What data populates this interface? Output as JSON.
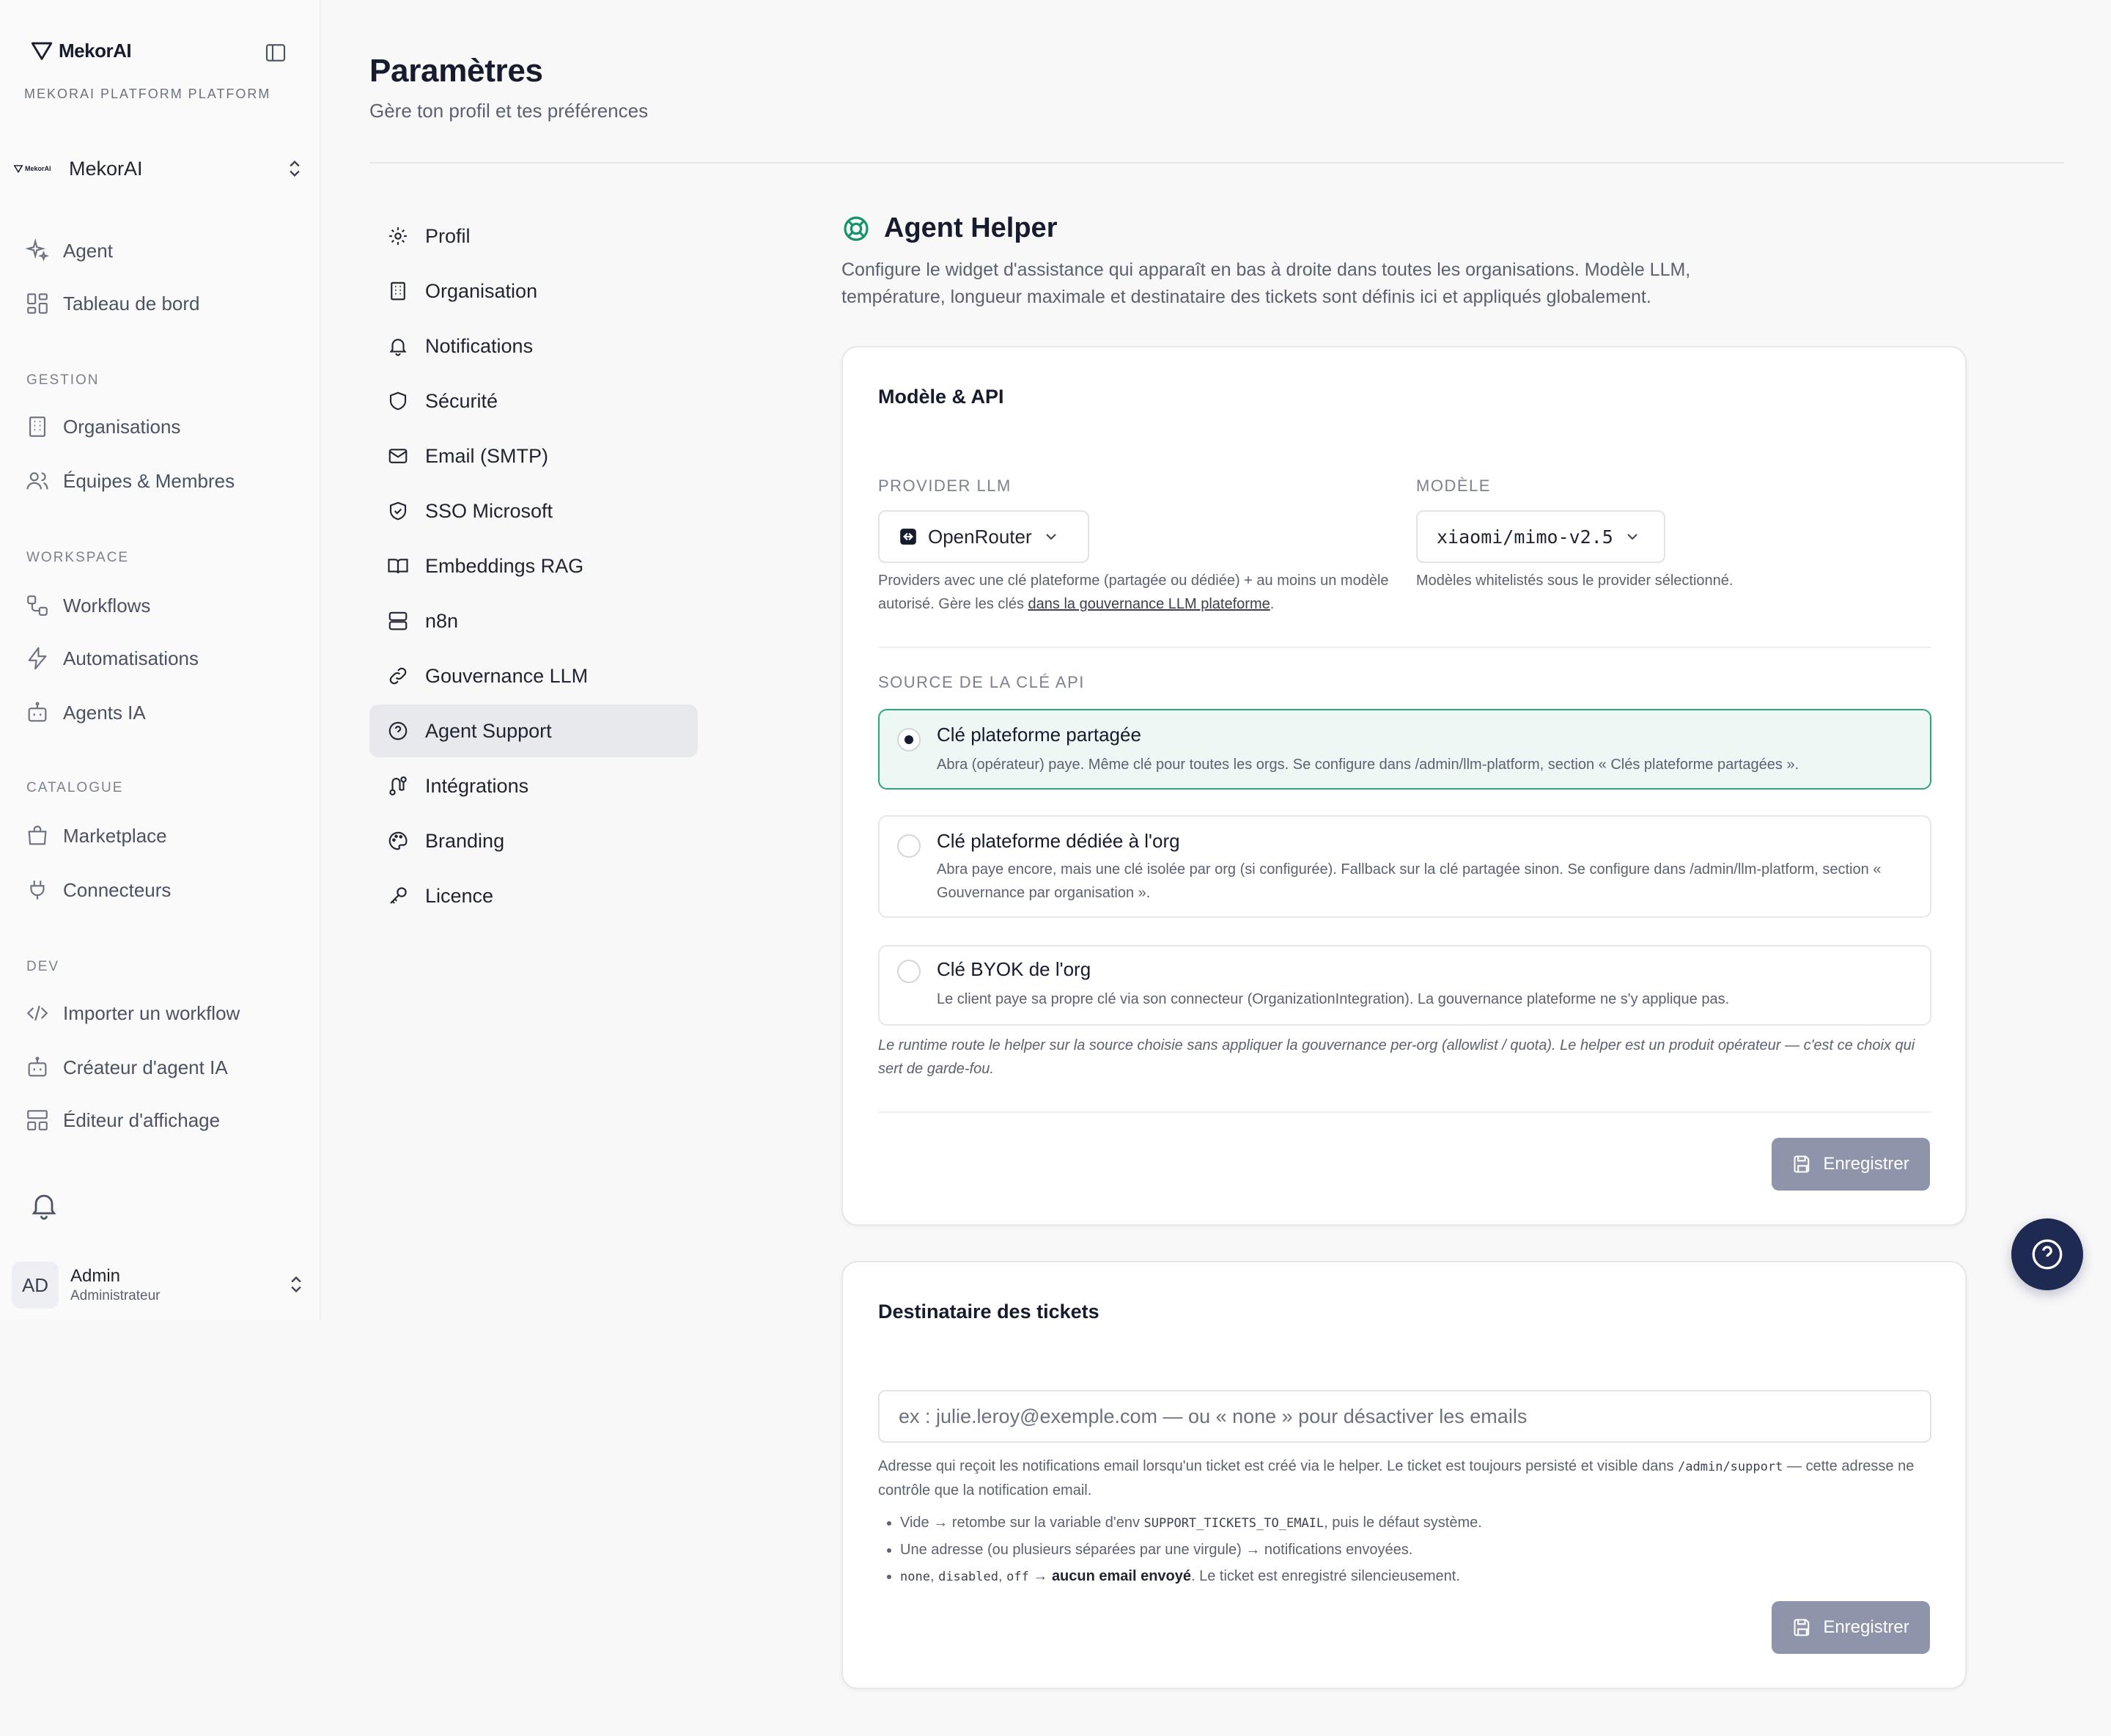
{
  "sidebar": {
    "brand": "MekorAI",
    "platform_label": "MEKORAI PLATFORM PLATFORM",
    "org": {
      "logo_text": "MekorAI",
      "name": "MekorAI"
    },
    "top_items": [
      {
        "label": "Agent",
        "icon": "sparkles-icon"
      },
      {
        "label": "Tableau de bord",
        "icon": "dashboard-icon"
      }
    ],
    "sections": [
      {
        "title": "GESTION",
        "items": [
          {
            "label": "Organisations",
            "icon": "building-icon"
          },
          {
            "label": "Équipes & Membres",
            "icon": "users-icon"
          }
        ]
      },
      {
        "title": "WORKSPACE",
        "items": [
          {
            "label": "Workflows",
            "icon": "workflow-icon"
          },
          {
            "label": "Automatisations",
            "icon": "zap-icon"
          },
          {
            "label": "Agents IA",
            "icon": "bot-icon"
          }
        ]
      },
      {
        "title": "CATALOGUE",
        "items": [
          {
            "label": "Marketplace",
            "icon": "store-icon"
          },
          {
            "label": "Connecteurs",
            "icon": "plug-icon"
          }
        ]
      },
      {
        "title": "DEV",
        "items": [
          {
            "label": "Importer un workflow",
            "icon": "code-icon"
          },
          {
            "label": "Créateur d'agent IA",
            "icon": "bot-icon"
          },
          {
            "label": "Éditeur d'affichage",
            "icon": "layout-icon"
          }
        ]
      }
    ],
    "user": {
      "initials": "AD",
      "name": "Admin",
      "role": "Administrateur"
    }
  },
  "header": {
    "title": "Paramètres",
    "subtitle": "Gère ton profil et tes préférences"
  },
  "settings_nav": [
    {
      "label": "Profil",
      "icon": "gear-icon"
    },
    {
      "label": "Organisation",
      "icon": "building-icon"
    },
    {
      "label": "Notifications",
      "icon": "bell-icon"
    },
    {
      "label": "Sécurité",
      "icon": "shield-icon"
    },
    {
      "label": "Email (SMTP)",
      "icon": "mail-icon"
    },
    {
      "label": "SSO Microsoft",
      "icon": "shield-check-icon"
    },
    {
      "label": "Embeddings RAG",
      "icon": "book-icon"
    },
    {
      "label": "n8n",
      "icon": "server-icon"
    },
    {
      "label": "Gouvernance LLM",
      "icon": "link-icon"
    },
    {
      "label": "Agent Support",
      "icon": "help-circle-icon",
      "active": true
    },
    {
      "label": "Intégrations",
      "icon": "route-icon"
    },
    {
      "label": "Branding",
      "icon": "palette-icon"
    },
    {
      "label": "Licence",
      "icon": "key-icon"
    }
  ],
  "section": {
    "title": "Agent Helper",
    "description": "Configure le widget d'assistance qui apparaît en bas à droite dans toutes les organisations. Modèle LLM, température, longueur maximale et destinataire des tickets sont définis ici et appliqués globalement."
  },
  "model_card": {
    "title": "Modèle & API",
    "provider": {
      "label": "PROVIDER LLM",
      "value": "OpenRouter",
      "help": "Providers avec une clé plateforme (partagée ou dédiée) + au moins un modèle autorisé. Gère les clés ",
      "help_link": "dans la gouvernance LLM plateforme",
      "help_end": "."
    },
    "model": {
      "label": "MODÈLE",
      "value": "xiaomi/mimo-v2.5",
      "help": "Modèles whitelistés sous le provider sélectionné."
    },
    "source": {
      "label": "SOURCE DE LA CLÉ API",
      "options": [
        {
          "title": "Clé plateforme partagée",
          "desc": "Abra (opérateur) paye. Même clé pour toutes les orgs. Se configure dans /admin/llm-platform, section « Clés plateforme partagées ».",
          "selected": true
        },
        {
          "title": "Clé plateforme dédiée à l'org",
          "desc": "Abra paye encore, mais une clé isolée par org (si configurée). Fallback sur la clé partagée sinon. Se configure dans /admin/llm-platform, section « Gouvernance par organisation ».",
          "selected": false
        },
        {
          "title": "Clé BYOK de l'org",
          "desc": "Le client paye sa propre clé via son connecteur (OrganizationIntegration). La gouvernance plateforme ne s'y applique pas.",
          "selected": false
        }
      ],
      "note": "Le runtime route le helper sur la source choisie sans appliquer la gouvernance per-org (allowlist / quota). Le helper est un produit opérateur — c'est ce choix qui sert de garde-fou."
    },
    "save_label": "Enregistrer"
  },
  "tickets_card": {
    "title": "Destinataire des tickets",
    "input_value": "",
    "input_placeholder": "ex : julie.leroy@exemple.com — ou « none » pour désactiver les emails",
    "help_a": "Adresse qui reçoit les notifications email lorsqu'un ticket est créé via le helper. Le ticket est toujours persisté et visible dans ",
    "help_code": "/admin/support",
    "help_b": " — cette adresse ne contrôle que la notification email.",
    "bullets": {
      "b1_a": "Vide → retombe sur la variable d'env ",
      "b1_code": "SUPPORT_TICKETS_TO_EMAIL",
      "b1_b": ", puis le défaut système.",
      "b2": "Une adresse (ou plusieurs séparées par une virgule) → notifications envoyées.",
      "b3_code1": "none",
      "b3_sep1": ", ",
      "b3_code2": "disabled",
      "b3_sep2": ", ",
      "b3_code3": "off",
      "b3_arrow": " → ",
      "b3_strong": "aucun email envoyé",
      "b3_end": ". Le ticket est enregistré silencieusement."
    },
    "save_label": "Enregistrer"
  },
  "colors": {
    "accent": "#14936b",
    "selected_border": "#2fa57e",
    "fab": "#1e2a52",
    "save_disabled": "#8e95aa"
  }
}
